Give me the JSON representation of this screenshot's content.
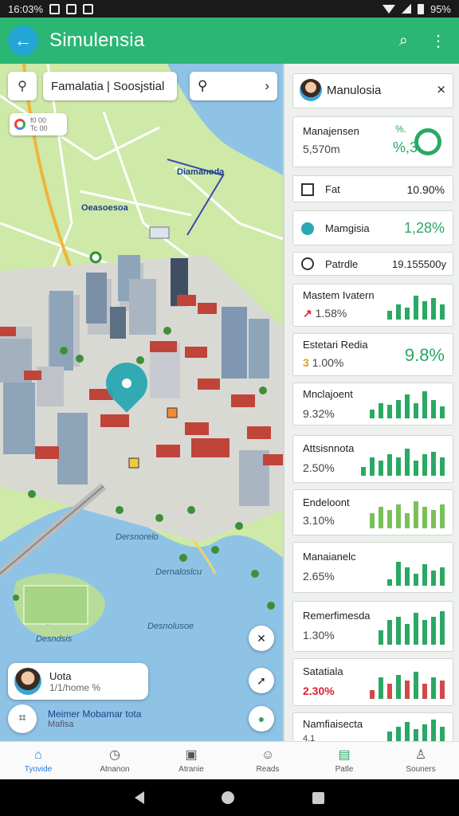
{
  "status": {
    "time": "16:03%",
    "battery": "95%"
  },
  "appbar": {
    "title": "Simulensia"
  },
  "map": {
    "search_text": "Famalatia | Soosjstial",
    "layer_chip_text": "f0 00\nTc 00",
    "labels": [
      "Diamanoda",
      "Oeasoesoa"
    ],
    "water_labels": [
      "Dersnorelo",
      "Dernaloslcu",
      "Desnolusoe"
    ],
    "park_label": "Desndsis",
    "floating_card": {
      "title": "Uota",
      "subtitle": "1/1/home %"
    },
    "user": {
      "name": "Meimer Mobamar tota",
      "sub": "Mafisa"
    }
  },
  "panel": {
    "header": {
      "title": "Manulosia"
    },
    "stats": [
      {
        "label": "Manajensen",
        "value": "5,570m",
        "pct": "%,3",
        "badge": "%."
      },
      {
        "label": "Fat",
        "pct": "10.90%"
      },
      {
        "label": "Mamgisia",
        "pct": "1,28%"
      },
      {
        "label": "Patrdle",
        "pct": "19.155500y"
      },
      {
        "label": "Mastem Ivatern",
        "value": "1.58%",
        "trend": "up"
      },
      {
        "label": "Estetari Redia",
        "value": "1.00%",
        "pct": "9.8%"
      },
      {
        "label": "Mnclajoent",
        "value": "9.32%"
      },
      {
        "label": "Attsisnnota",
        "value": "2.50%"
      },
      {
        "label": "Endeloont",
        "value": "3.10%"
      },
      {
        "label": "Manaianelc",
        "value": "2.65%"
      },
      {
        "label": "Remerfimesda",
        "value": "1.30%"
      },
      {
        "label": "Satatiala",
        "value": "2.30%"
      },
      {
        "label": "Namfiaisecta",
        "value": "4.1"
      }
    ],
    "bars": {
      "s4": [
        0.3,
        0.5,
        0.4,
        0.8,
        0.6,
        0.7,
        0.5
      ],
      "s6": [
        0.3,
        0.5,
        0.45,
        0.6,
        0.8,
        0.5,
        0.9,
        0.6,
        0.4
      ],
      "s7": [
        0.3,
        0.6,
        0.5,
        0.7,
        0.6,
        0.9,
        0.5,
        0.7,
        0.8,
        0.6
      ],
      "s8": [
        0.5,
        0.7,
        0.6,
        0.8,
        0.5,
        0.9,
        0.7,
        0.6,
        0.8
      ],
      "s9": [
        0.2,
        0.8,
        0.6,
        0.4,
        0.7,
        0.5,
        0.6
      ],
      "s10": [
        0.4,
        0.7,
        0.8,
        0.6,
        0.9,
        0.7,
        0.8,
        0.95
      ],
      "s11": [
        0.3,
        0.7,
        0.5,
        0.8,
        0.6,
        0.9,
        0.5,
        0.7,
        0.6
      ],
      "s12": [
        0.4,
        0.6,
        0.8,
        0.5,
        0.7,
        0.9,
        0.6
      ]
    }
  },
  "bottomnav": [
    {
      "label": "Tyovide",
      "icon": "home-icon"
    },
    {
      "label": "Atnanon",
      "icon": "clock-icon"
    },
    {
      "label": "Atranie",
      "icon": "briefcase-icon"
    },
    {
      "label": "Reads",
      "icon": "cat-icon"
    },
    {
      "label": "Patle",
      "icon": "card-icon"
    },
    {
      "label": "Souners",
      "icon": "person-icon"
    }
  ],
  "colors": {
    "accent": "#2bb673",
    "pin": "#2aa8b3",
    "bar": "#2aa864"
  }
}
